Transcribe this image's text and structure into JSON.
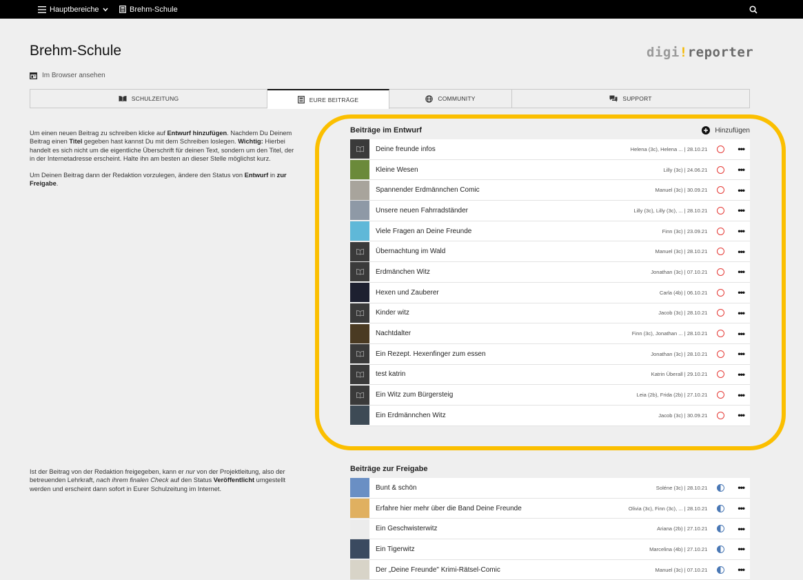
{
  "topbar": {
    "menu_label": "Hauptbereiche",
    "site_label": "Brehm-Schule"
  },
  "page": {
    "title": "Brehm-Schule",
    "browser_link": "Im Browser ansehen",
    "logo_digi": "digi",
    "logo_bang": "!",
    "logo_reporter": "reporter"
  },
  "tabs": [
    {
      "label": "SCHULZEITUNG",
      "icon": "newspaper-icon"
    },
    {
      "label": "EURE BEITRÄGE",
      "icon": "article-icon"
    },
    {
      "label": "COMMUNITY",
      "icon": "globe-icon"
    },
    {
      "label": "SUPPORT",
      "icon": "chat-icon"
    }
  ],
  "info_draft": {
    "p1_a": "Um einen neuen Beitrag zu schreiben klicke auf ",
    "p1_b": "Entwurf hinzufügen",
    "p1_c": ". Nachdem Du Deinem Beitrag einen ",
    "p1_d": "Titel",
    "p1_e": " gegeben hast kannst Du mit dem Schreiben loslegen. ",
    "p1_f": "Wichtig:",
    "p1_g": " Hierbei handelt es sich nicht um die eigentliche Überschrift für deinen Text, sondern um den Titel, der in der Internetadresse erscheint. Halte ihn am besten an dieser Stelle möglichst kurz.",
    "p2_a": "Um Deinen Beitrag dann der Redaktion vorzulegen, ändere den Status von ",
    "p2_b": "Entwurf",
    "p2_c": " in ",
    "p2_d": "zur Freigabe",
    "p2_e": "."
  },
  "info_review": {
    "a": "Ist der Beitrag von der Redaktion freigegeben, kann er ",
    "b": "nur",
    "c": " von der Projektleitung, also der betreuenden Lehrkraft, ",
    "d": "nach ihrem finalen Check",
    "e": " auf den Status ",
    "f": "Veröffentlicht",
    "g": " umgestellt werden und erscheint dann sofort in Eurer Schulzeitung im Internet."
  },
  "drafts": {
    "title": "Beiträge im Entwurf",
    "add_label": "Hinzufügen",
    "rows": [
      {
        "title": "Deine freunde infos",
        "meta": "Helena (3c), Helena ... | 28.10.21",
        "thumb": "placeholder"
      },
      {
        "title": "Kleine Wesen",
        "meta": "Lilly (3c) | 24.06.21",
        "thumb": "#6b8a3a"
      },
      {
        "title": "Spannender Erdmännchen Comic",
        "meta": "Manuel (3c) | 30.09.21",
        "thumb": "#a8a49c"
      },
      {
        "title": "Unsere neuen Fahrradständer",
        "meta": "Lilly (3c), Lilly (3c), ... | 28.10.21",
        "thumb": "#8e99a6"
      },
      {
        "title": "Viele Fragen an Deine Freunde",
        "meta": "Finn (3c) | 23.09.21",
        "thumb": "#5fb8d8"
      },
      {
        "title": "Übernachtung im Wald",
        "meta": "Manuel (3c) | 28.10.21",
        "thumb": "placeholder"
      },
      {
        "title": "Erdmänchen Witz",
        "meta": "Jonathan (3c) | 07.10.21",
        "thumb": "placeholder"
      },
      {
        "title": "Hexen und Zauberer",
        "meta": "Carla (4b) | 06.10.21",
        "thumb": "#1d2030"
      },
      {
        "title": "Kinder witz",
        "meta": "Jacob (3c) | 28.10.21",
        "thumb": "placeholder"
      },
      {
        "title": "Nachtdalter",
        "meta": "Finn (3c), Jonathan ... | 28.10.21",
        "thumb": "#4a3a22"
      },
      {
        "title": "Ein Rezept. Hexenfinger zum essen",
        "meta": "Jonathan (3c) | 28.10.21",
        "thumb": "placeholder"
      },
      {
        "title": "test katrin",
        "meta": "Katrin Überall | 29.10.21",
        "thumb": "placeholder"
      },
      {
        "title": "Ein Witz zum Bürgersteig",
        "meta": "Leia (2b), Frida (2b) | 27.10.21",
        "thumb": "placeholder"
      },
      {
        "title": "Ein Erdmännchen Witz",
        "meta": "Jacob (3c) | 30.09.21",
        "thumb": "#3d4a55"
      }
    ]
  },
  "review": {
    "title": "Beiträge zur Freigabe",
    "rows": [
      {
        "title": "Bunt & schön",
        "meta": "Soléne (3c) | 28.10.21",
        "thumb": "#6a8fc4"
      },
      {
        "title": "Erfahre hier mehr über die Band Deine Freunde",
        "meta": "Olivia (3c), Finn (3c), ... | 28.10.21",
        "thumb": "#e0b060"
      },
      {
        "title": "Ein Geschwisterwitz",
        "meta": "Ariana (2b) | 27.10.21",
        "thumb": "#ececec"
      },
      {
        "title": "Ein Tigerwitz",
        "meta": "Marcelina (4b) | 27.10.21",
        "thumb": "#3a4a60"
      },
      {
        "title": "Der „Deine Freunde\" Krimi-Rätsel-Comic",
        "meta": "Manuel (3c) | 07.10.21",
        "thumb": "#d8d4c8"
      }
    ]
  },
  "colors": {
    "highlight": "#fbbf00",
    "draft_status": "#e53935",
    "review_status": "#4a78b5"
  }
}
